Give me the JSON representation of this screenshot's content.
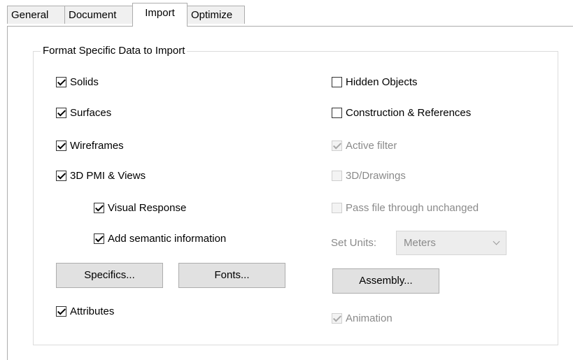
{
  "tabs": [
    {
      "label": "General"
    },
    {
      "label": "Document"
    },
    {
      "label": "Import"
    },
    {
      "label": "Optimize"
    }
  ],
  "active_tab": "Import",
  "group_title": "Format Specific Data to Import",
  "checkboxes": {
    "solids": {
      "label": "Solids",
      "checked": true,
      "enabled": true
    },
    "surfaces": {
      "label": "Surfaces",
      "checked": true,
      "enabled": true
    },
    "wireframes": {
      "label": "Wireframes",
      "checked": true,
      "enabled": true
    },
    "pmi_views": {
      "label": "3D PMI & Views",
      "checked": true,
      "enabled": true
    },
    "visual_response": {
      "label": "Visual Response",
      "checked": true,
      "enabled": true
    },
    "semantic_info": {
      "label": "Add semantic information",
      "checked": true,
      "enabled": true
    },
    "attributes": {
      "label": "Attributes",
      "checked": true,
      "enabled": true
    },
    "hidden_objects": {
      "label": "Hidden Objects",
      "checked": false,
      "enabled": true
    },
    "construction_refs": {
      "label": "Construction & References",
      "checked": false,
      "enabled": true
    },
    "active_filter": {
      "label": "Active filter",
      "checked": true,
      "enabled": false
    },
    "drawings_3d": {
      "label": "3D/Drawings",
      "checked": false,
      "enabled": false
    },
    "pass_through": {
      "label": "Pass file through unchanged",
      "checked": false,
      "enabled": false
    },
    "animation": {
      "label": "Animation",
      "checked": true,
      "enabled": false
    }
  },
  "buttons": {
    "specifics": "Specifics...",
    "fonts": "Fonts...",
    "assembly": "Assembly..."
  },
  "units": {
    "label": "Set Units:",
    "value": "Meters",
    "enabled": false
  }
}
